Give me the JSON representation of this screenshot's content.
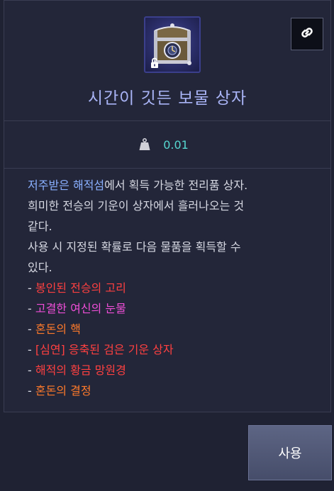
{
  "item": {
    "name": "시간이 깃든 보물 상자",
    "icon": "treasure-chest-icon",
    "locked_badge_icon": "lock-icon"
  },
  "toolbar": {
    "link_icon": "link-icon"
  },
  "weight": {
    "icon": "weight-icon",
    "value": "0.01"
  },
  "description": {
    "line1_highlight_1": "저주받은",
    "line1_space": " ",
    "line1_highlight_2": "해적섬",
    "line1_rest": "에서 획득 가능한 전리품 상자.",
    "line2": "희미한 전승의 기운이 상자에서 흘러나오는 것",
    "line3": "같다.",
    "line4": "사용 시 지정된 확률로 다음 물품을 획득할 수",
    "line5": "있다."
  },
  "rewards": [
    {
      "prefix": "- ",
      "name": "봉인된 전승의 고리",
      "color": "#ff4040"
    },
    {
      "prefix": "- ",
      "name": "고결한 여신의 눈물",
      "color": "#f04ed8"
    },
    {
      "prefix": "- ",
      "name": "혼돈의 핵",
      "color": "#ff7a2a"
    },
    {
      "prefix": "- ",
      "name": "[심연] 응축된 검은 기운 상자",
      "color": "#ff4040"
    },
    {
      "prefix": "- ",
      "name": "해적의 황금 망원경",
      "color": "#ff4040"
    },
    {
      "prefix": "- ",
      "name": "혼돈의 결정",
      "color": "#ff7a2a"
    }
  ],
  "actions": {
    "use_label": "사용"
  },
  "colors": {
    "title": "#a9b4f6",
    "weight_value": "#56d7d0",
    "highlight_name": "#8ab0ff"
  }
}
